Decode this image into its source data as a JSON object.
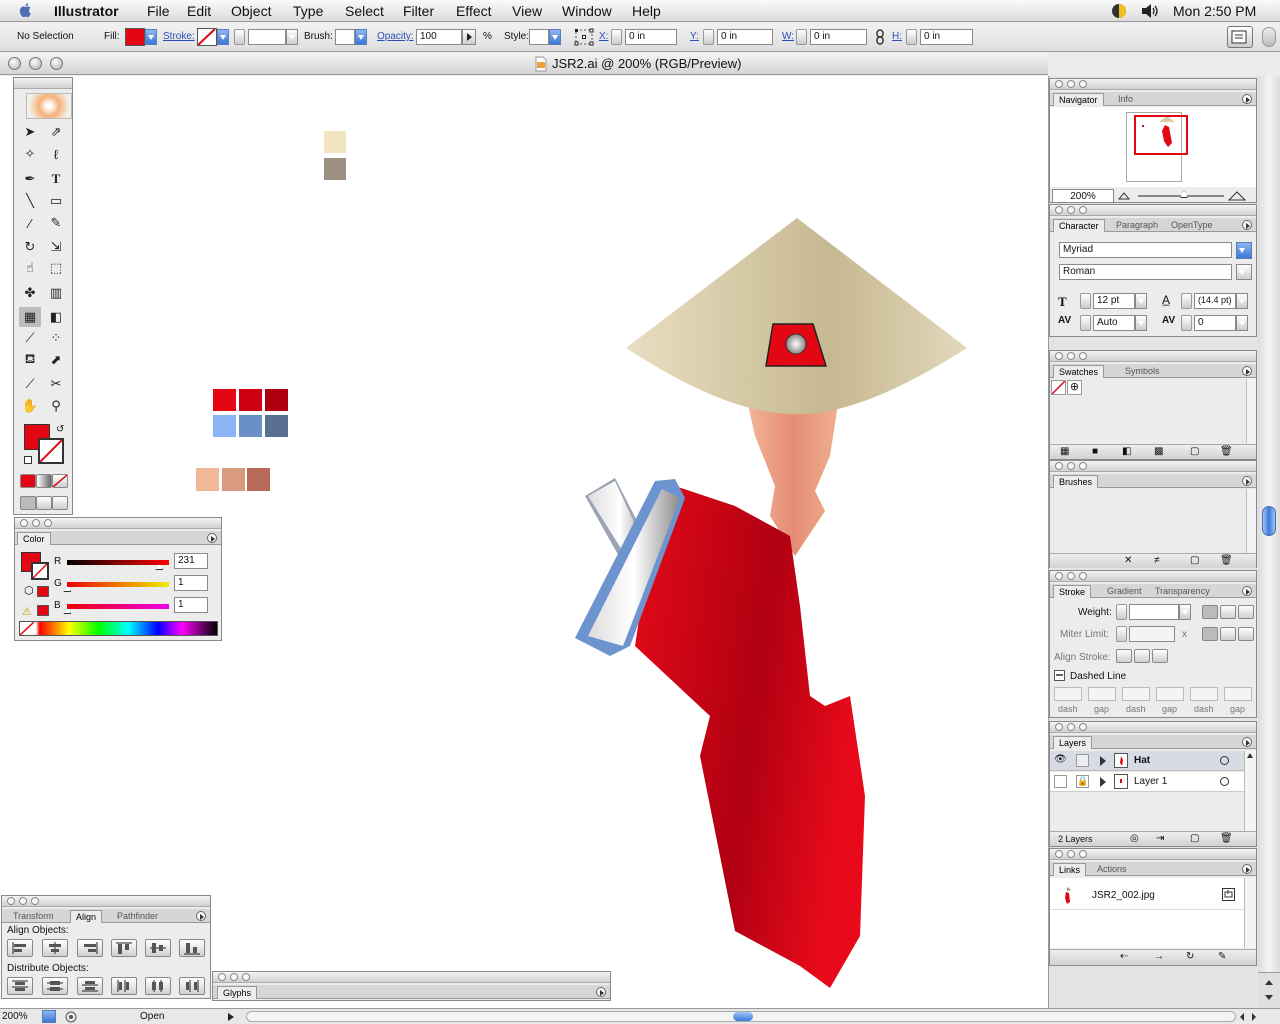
{
  "menubar": {
    "app_name": "Illustrator",
    "items": [
      "File",
      "Edit",
      "Object",
      "Type",
      "Select",
      "Filter",
      "Effect",
      "View",
      "Window",
      "Help"
    ],
    "clock": "Mon 2:50 PM"
  },
  "control": {
    "selection": "No Selection",
    "fill_label": "Fill:",
    "stroke_label": "Stroke:",
    "brush_label": "Brush:",
    "opacity_label": "Opacity:",
    "opacity_value": "100",
    "percent": "%",
    "style_label": "Style:",
    "x_label": "X:",
    "x_value": "0 in",
    "y_label": "Y:",
    "y_value": "0 in",
    "w_label": "W:",
    "w_value": "0 in",
    "h_label": "H:",
    "h_value": "0 in"
  },
  "document": {
    "title": "JSR2.ai @ 200% (RGB/Preview)"
  },
  "navigator": {
    "tabs": [
      "Navigator",
      "Info"
    ],
    "zoom": "200%"
  },
  "character": {
    "tabs": [
      "Character",
      "Paragraph",
      "OpenType"
    ],
    "font": "Myriad",
    "style": "Roman",
    "size": "12 pt",
    "leading": "(14.4 pt)",
    "kerning": "Auto",
    "tracking": "0"
  },
  "swatches": {
    "tabs": [
      "Swatches",
      "Symbols"
    ]
  },
  "brushes": {
    "tabs": [
      "Brushes"
    ]
  },
  "stroke": {
    "tabs": [
      "Stroke",
      "Gradient",
      "Transparency"
    ],
    "weight_label": "Weight:",
    "miter_label": "Miter Limit:",
    "miter_x": "x",
    "align_label": "Align Stroke:",
    "dashed_label": "Dashed Line",
    "dash_labels": [
      "dash",
      "gap",
      "dash",
      "gap",
      "dash",
      "gap"
    ]
  },
  "layers": {
    "tabs": [
      "Layers"
    ],
    "rows": [
      {
        "name": "Hat"
      },
      {
        "name": "Layer 1"
      }
    ],
    "count": "2 Layers"
  },
  "links": {
    "tabs": [
      "Links",
      "Actions"
    ],
    "file": "JSR2_002.jpg"
  },
  "color": {
    "tab": "Color",
    "r_label": "R",
    "r_value": "231",
    "r_level": 0.906,
    "g_label": "G",
    "g_value": "1",
    "g_level": 0.004,
    "b_label": "B",
    "b_value": "1",
    "b_level": 0.004
  },
  "align": {
    "tabs": [
      "Transform",
      "Align",
      "Pathfinder"
    ],
    "align_label": "Align Objects:",
    "distribute_label": "Distribute Objects:"
  },
  "glyphs": {
    "tab": "Glyphs"
  },
  "status": {
    "zoom": "200%",
    "info": "Open"
  },
  "colors": {
    "fill": "#e30613",
    "hat": "#d8ccaa",
    "skin": "#e8927a",
    "dress": "#e8101e"
  }
}
